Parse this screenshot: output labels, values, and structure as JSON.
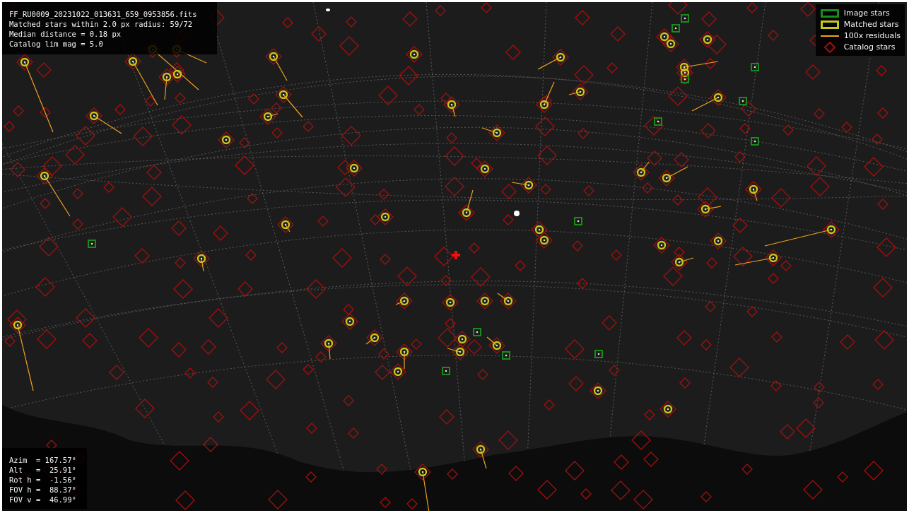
{
  "info": {
    "lines": [
      "FF_RU0009_20231022_013631_659_0953856.fits",
      "Matched stars within 2.0 px radius: 59/72",
      "Median distance = 0.18 px",
      "Catalog lim mag = 5.0"
    ]
  },
  "legend": [
    {
      "kind": "image",
      "label": "Image stars",
      "color": "#1a8a1a"
    },
    {
      "kind": "matched",
      "label": "Matched stars",
      "color": "#c8c81a"
    },
    {
      "kind": "residual",
      "label": "100x residuals",
      "color": "#f0a020"
    },
    {
      "kind": "catalog",
      "label": "Catalog stars",
      "color": "#a01010"
    }
  ],
  "pointing": {
    "lines": [
      "Azim  = 167.57°",
      "Alt   =  25.91°",
      "Rot h =  -1.56°",
      "FOV h =  88.37°",
      "FOV v =  46.99°"
    ]
  }
}
